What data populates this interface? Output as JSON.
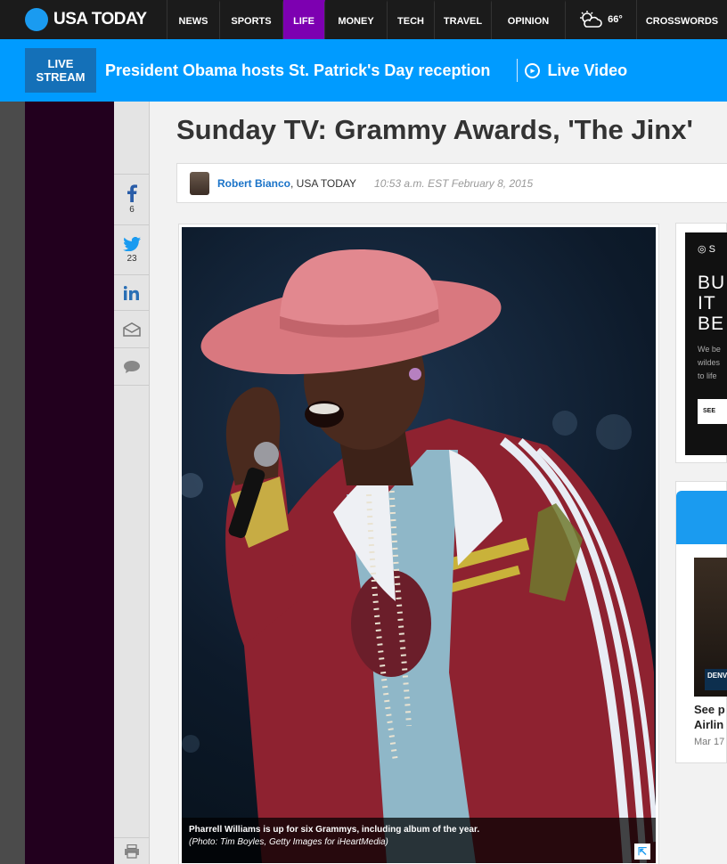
{
  "brand": {
    "name": "USA TODAY",
    "accent": "#1a9bf0"
  },
  "nav": {
    "items": [
      {
        "label": "NEWS",
        "active": false
      },
      {
        "label": "SPORTS",
        "active": false
      },
      {
        "label": "LIFE",
        "active": true
      },
      {
        "label": "MONEY",
        "active": false
      },
      {
        "label": "TECH",
        "active": false
      },
      {
        "label": "TRAVEL",
        "active": false
      },
      {
        "label": "OPINION",
        "active": false
      }
    ],
    "weather": {
      "icon": "partly-cloudy-icon",
      "temp": "66°"
    },
    "crosswords": "CROSSWORDS"
  },
  "breaking": {
    "badge_line1": "LIVE",
    "badge_line2": "STREAM",
    "headline": "President Obama hosts St. Patrick's Day reception",
    "live_video": "Live Video"
  },
  "share": {
    "facebook": {
      "icon": "facebook-icon",
      "count": "6"
    },
    "twitter": {
      "icon": "twitter-icon",
      "count": "23"
    },
    "linkedin": {
      "icon": "linkedin-icon"
    },
    "email": {
      "icon": "email-icon"
    },
    "comment": {
      "icon": "comment-icon"
    },
    "print": {
      "icon": "print-icon"
    }
  },
  "article": {
    "title": "Sunday TV: Grammy Awards, 'The Jinx'",
    "author": "Robert Bianco",
    "outlet": ", USA TODAY",
    "timestamp": "10:53 a.m. EST February 8, 2015",
    "photo": {
      "caption": "Pharrell Williams is up for six Grammys, including album of the year.",
      "credit": "(Photo: Tim Boyles, Getty Images for iHeartMedia)"
    }
  },
  "ad": {
    "brand_fragment": "S",
    "big_lines": [
      "BU",
      "IT",
      "BE"
    ],
    "small_lines": [
      "We be",
      "wildes",
      "to life"
    ],
    "button": "SEE"
  },
  "promo": {
    "tag": "DENV",
    "title_line1": "See p",
    "title_line2": "Airlin",
    "date": "Mar 17"
  }
}
